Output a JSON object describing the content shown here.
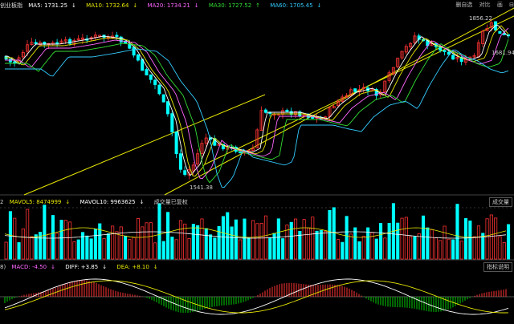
{
  "price_legend": {
    "index_name": "创业板指",
    "items": [
      {
        "label": "MA5: 1731.25",
        "arrow": "↓",
        "color": "#ffffff"
      },
      {
        "label": "MA10: 1732.64",
        "arrow": "↓",
        "color": "#e6e600"
      },
      {
        "label": "MA20: 1734.21",
        "arrow": "↓",
        "color": "#ff66ff"
      },
      {
        "label": "MA30: 1727.52",
        "arrow": "↑",
        "color": "#33dd33"
      },
      {
        "label": "MA60: 1705.45",
        "arrow": "↓",
        "color": "#33ccff"
      }
    ]
  },
  "toolbar": {
    "items": [
      "删自选",
      "对比",
      "画",
      "⊟"
    ]
  },
  "price_annotations": {
    "high": "1856.22",
    "low": "1541.38",
    "right_mark": "1681.94"
  },
  "volume_legend": {
    "prefix": "2",
    "items": [
      {
        "label": "MAVOL5: 8474999",
        "arrow": "↓",
        "color": "#e6e600"
      },
      {
        "label": "MAVOL10: 9963625",
        "arrow": "↓",
        "color": "#ffffff"
      }
    ],
    "note": "成交量已复权",
    "tag": "成交量"
  },
  "macd_legend": {
    "prefix": "8)",
    "items": [
      {
        "label": "MACD: -4.50",
        "arrow": "↓",
        "color": "#ff66ff"
      },
      {
        "label": "DIFF: +3.85",
        "arrow": "↓",
        "color": "#ffffff"
      },
      {
        "label": "DEA: +8.10",
        "arrow": "↓",
        "color": "#e6e600"
      }
    ],
    "tag": "指标说明"
  },
  "colors": {
    "up": "#ff3333",
    "down": "#00ffff",
    "macd_up": "#ff3333",
    "macd_down": "#00cc00",
    "channel": "#e6e600"
  }
}
